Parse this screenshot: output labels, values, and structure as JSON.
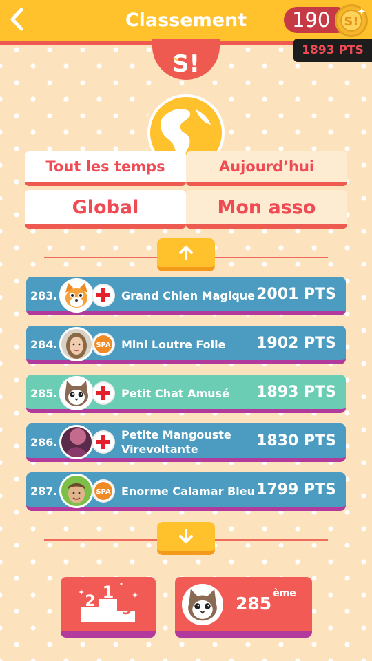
{
  "header": {
    "title": "Classement",
    "coins": "190",
    "points_badge": "1893 PTS"
  },
  "colors": {
    "header": "#ffc12c",
    "accent_red": "#ef5a50",
    "row_blue": "#4b9cc0",
    "row_highlight": "#6ccdb5",
    "row_border": "#b23a9c",
    "background": "#fde3bd"
  },
  "tabs": {
    "period": [
      {
        "label": "Tout les temps",
        "active": true
      },
      {
        "label": "Aujourd’hui",
        "active": false
      }
    ],
    "scope": [
      {
        "label": "Global",
        "active": true
      },
      {
        "label": "Mon asso",
        "active": false
      }
    ]
  },
  "ranking": [
    {
      "rank": "283.",
      "name": "Grand Chien Magique",
      "points": "2001 PTS",
      "avatar": "fox-avatar",
      "asso": "red-cross-icon",
      "highlight": false
    },
    {
      "rank": "284.",
      "name": "Mini Loutre Folle",
      "points": "1902 PTS",
      "avatar": "photo-woman-avatar",
      "asso": "spa-logo-icon",
      "highlight": false
    },
    {
      "rank": "285.",
      "name": "Petit Chat Amusé",
      "points": "1893 PTS",
      "avatar": "cat-avatar",
      "asso": "red-cross-icon",
      "highlight": true
    },
    {
      "rank": "286.",
      "name_line1": "Petite Mangouste",
      "name_line2": "Virevoltante",
      "points": "1830 PTS",
      "avatar": "photo-purple-avatar",
      "asso": "red-cross-icon",
      "highlight": false
    },
    {
      "rank": "287.",
      "name": "Enorme Calamar Bleu",
      "points": "1799 PTS",
      "avatar": "photo-boy-avatar",
      "asso": "spa-logo-icon",
      "highlight": false
    }
  ],
  "bottom": {
    "podium_numbers": [
      "1",
      "2",
      "3"
    ],
    "my_rank": "285",
    "my_rank_suffix": "ème"
  }
}
